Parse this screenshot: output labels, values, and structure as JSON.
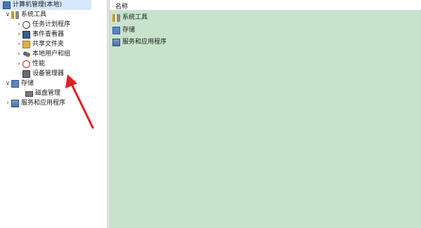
{
  "tree": {
    "root": "计算机管理(本地)",
    "system_tools": "系统工具",
    "task_scheduler": "任务计划程序",
    "event_viewer": "事件查看器",
    "shared_folders": "共享文件夹",
    "local_users": "本地用户和组",
    "performance": "性能",
    "device_manager": "设备管理器",
    "storage": "存储",
    "disk_management": "磁盘管理",
    "services_apps": "服务和应用程序",
    "expanded_chevron": "∨",
    "collapsed_chevron": "›"
  },
  "main": {
    "column_header": "名称",
    "items": [
      "系统工具",
      "存储",
      "服务和应用程序"
    ]
  },
  "colors": {
    "content_bg": "#c7e3cc",
    "arrow": "#e02020"
  },
  "icons": {
    "root": "computer-management-icon",
    "system_tools": "tools-icon",
    "task_scheduler": "clock-icon",
    "event_viewer": "event-log-icon",
    "shared_folders": "shared-folder-icon",
    "local_users": "users-icon",
    "performance": "performance-icon",
    "device_manager": "device-icon",
    "storage": "storage-icon",
    "disk_management": "disk-icon",
    "services_apps": "services-icon"
  }
}
